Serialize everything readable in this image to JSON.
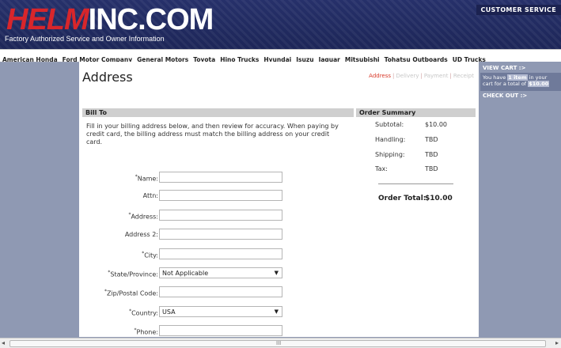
{
  "header": {
    "logo_part1": "HELM",
    "logo_part2": "INC.COM",
    "tagline": "Factory Authorized Service and Owner Information",
    "customer_service": "CUSTOMER SERVICE"
  },
  "nav": {
    "items": [
      "American Honda",
      "Ford Motor Company",
      "General Motors",
      "Toyota",
      "Hino Trucks",
      "Hyundai",
      "Isuzu",
      "Jaguar",
      "Mitsubishi",
      "Tohatsu Outboards",
      "UD Trucks"
    ]
  },
  "page": {
    "title": "Address"
  },
  "steps": [
    "Address",
    "Delivery",
    "Payment",
    "Receipt"
  ],
  "bill_to": {
    "header": "Bill To",
    "intro": "Fill in your billing address below, and then review for accuracy.  When paying by credit card, the billing address must match the billing address on your credit card.",
    "fields": [
      {
        "label": "Name:",
        "required": true,
        "type": "text",
        "value": ""
      },
      {
        "label": "Attn:",
        "required": false,
        "type": "text",
        "value": ""
      },
      {
        "label": "Address:",
        "required": true,
        "type": "text",
        "value": ""
      },
      {
        "label": "Address 2:",
        "required": false,
        "type": "text",
        "value": ""
      },
      {
        "label": "City:",
        "required": true,
        "type": "text",
        "value": ""
      },
      {
        "label": "State/Province:",
        "required": true,
        "type": "select",
        "value": "Not Applicable"
      },
      {
        "label": "Zip/Postal Code:",
        "required": true,
        "type": "text",
        "value": ""
      },
      {
        "label": "Country:",
        "required": true,
        "type": "select",
        "value": "USA"
      },
      {
        "label": "Phone:",
        "required": true,
        "type": "text",
        "value": ""
      }
    ]
  },
  "order_summary": {
    "header": "Order Summary",
    "rows": [
      {
        "label": "Subtotal:",
        "value": "$10.00"
      },
      {
        "label": "Handling:",
        "value": "TBD"
      },
      {
        "label": "Shipping:",
        "value": "TBD"
      },
      {
        "label": "Tax:",
        "value": "TBD"
      }
    ],
    "total_label": "Order Total:",
    "total_value": "$10.00"
  },
  "cart": {
    "view_label": "VIEW CART :>",
    "text_before": "You have",
    "item_count": "1 item",
    "text_middle": "in your cart for a total of",
    "total": "$10.00",
    "checkout_label": "CHECK OUT :>"
  },
  "scrollbar": {
    "grip": "III"
  },
  "colors": {
    "header_bg": "#26306a",
    "logo_red": "#d8262b",
    "side_bg": "#8f99b3",
    "active_step": "#d83a2a"
  }
}
